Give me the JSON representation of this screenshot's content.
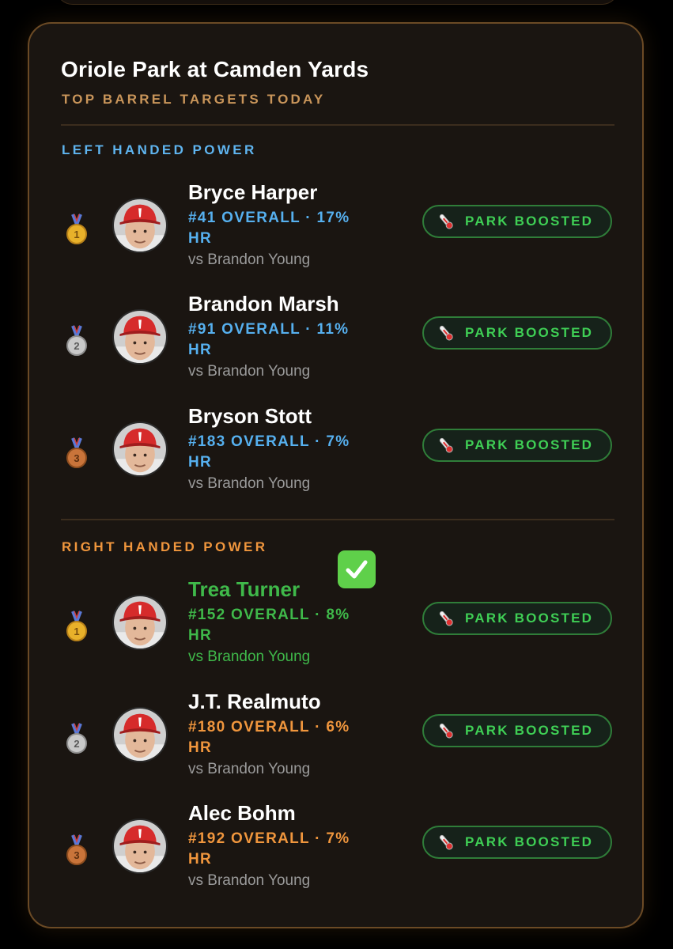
{
  "park": {
    "name": "Oriole Park at Camden Yards",
    "subtitle": "TOP BARREL TARGETS TODAY"
  },
  "colors": {
    "lhp": "#5fb4ef",
    "rhp": "#f0963d",
    "green": "#3fb94a",
    "card_border": "#6b4a25"
  },
  "sections": [
    {
      "label": "LEFT HANDED POWER",
      "players": [
        {
          "medal": "gold-medal",
          "medal_number": "1",
          "name": "Bryce Harper",
          "rank_line1": "#41 OVERALL · 17%",
          "rank_line2": "HR",
          "opponent": "vs Brandon Young",
          "badge": "PARK BOOSTED",
          "badge_icon": "thermometer-icon"
        },
        {
          "medal": "silver-medal",
          "medal_number": "2",
          "name": "Brandon Marsh",
          "rank_line1": "#91 OVERALL · 11%",
          "rank_line2": "HR",
          "opponent": "vs Brandon Young",
          "badge": "PARK BOOSTED",
          "badge_icon": "thermometer-icon"
        },
        {
          "medal": "bronze-medal",
          "medal_number": "3",
          "name": "Bryson Stott",
          "rank_line1": "#183 OVERALL · 7%",
          "rank_line2": "HR",
          "opponent": "vs Brandon Young",
          "badge": "PARK BOOSTED",
          "badge_icon": "thermometer-icon"
        }
      ]
    },
    {
      "label": "RIGHT HANDED POWER",
      "players": [
        {
          "medal": "gold-medal",
          "medal_number": "1",
          "name": "Trea Turner",
          "rank_line1": "#152 OVERALL · 8%",
          "rank_line2": "HR",
          "opponent": "vs Brandon Young",
          "badge": "PARK BOOSTED",
          "badge_icon": "thermometer-icon",
          "check_icon": "check-mark-icon"
        },
        {
          "medal": "silver-medal",
          "medal_number": "2",
          "name": "J.T. Realmuto",
          "rank_line1": "#180 OVERALL · 6%",
          "rank_line2": "HR",
          "opponent": "vs Brandon Young",
          "badge": "PARK BOOSTED",
          "badge_icon": "thermometer-icon"
        },
        {
          "medal": "bronze-medal",
          "medal_number": "3",
          "name": "Alec Bohm",
          "rank_line1": "#192 OVERALL · 7%",
          "rank_line2": "HR",
          "opponent": "vs Brandon Young",
          "badge": "PARK BOOSTED",
          "badge_icon": "thermometer-icon"
        }
      ]
    }
  ]
}
